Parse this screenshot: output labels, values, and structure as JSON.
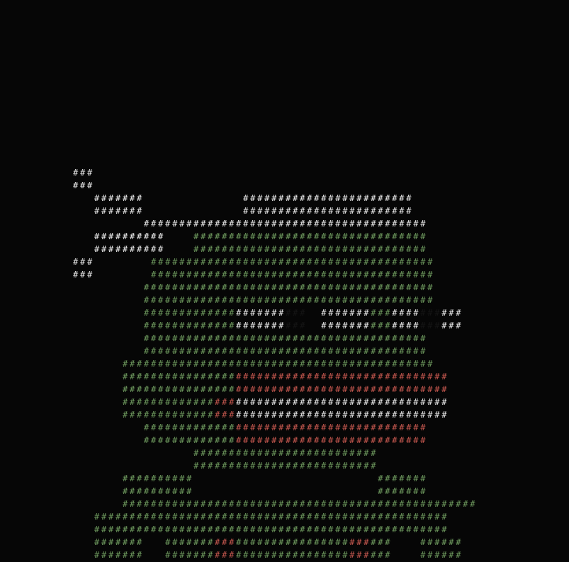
{
  "palette": {
    "background": "#060606",
    "w": "#eeeeee",
    "g": "#6e9a5e",
    "r": "#c4574e",
    "k": "#151515"
  },
  "terminal": {
    "lines": [
      "w###",
      "w###",
      "   w#######              w########################",
      "   w#######              w########################",
      "          w########################################",
      "   w##########    g#################################",
      "   w##########    g#################################",
      "w###        g########################################",
      "w###        g########################################",
      "          g#########################################",
      "          g#########################################",
      "          g#############w#######k###  w#######g###w####k###w###",
      "          g#############w#######k###  w#######g###w####k###w###",
      "          g########################################",
      "          g########################################",
      "       g############################################",
      "       g################r##############################",
      "       g################r##############################",
      "       g#############r###w##############################",
      "       g#############r###w##############################",
      "          g#############r###########################",
      "          g#############r###########################",
      "                 g##########################",
      "                 g##########################",
      "       g##########                          g#######",
      "       g##########                          g#######",
      "       g##################################################",
      "   g##################################################",
      "   g##################################################",
      "   g#######   g#######r###g################r###g###    g######",
      "   g#######   g#######r###g################r###g###    g######"
    ]
  }
}
